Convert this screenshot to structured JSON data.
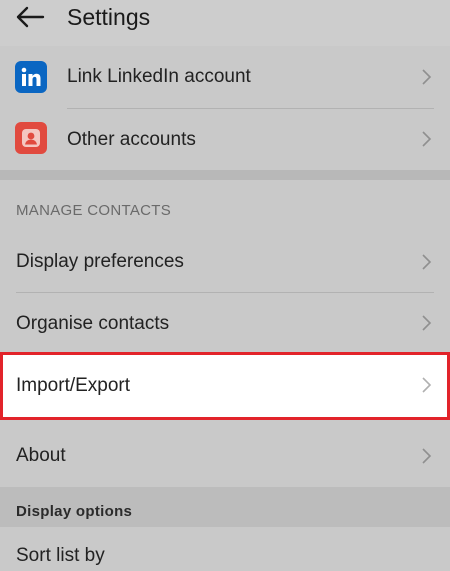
{
  "header": {
    "title": "Settings"
  },
  "accounts": [
    {
      "label": "Link LinkedIn account",
      "icon": "linkedin-icon",
      "color": "#0a66c2"
    },
    {
      "label": "Other accounts",
      "icon": "account-icon",
      "color": "#e14a3f"
    }
  ],
  "manage_contacts": {
    "section_title": "MANAGE CONTACTS",
    "items": [
      {
        "label": "Display preferences"
      },
      {
        "label": "Organise contacts"
      },
      {
        "label": "Import/Export",
        "highlighted": true
      },
      {
        "label": "About"
      }
    ]
  },
  "display_options": {
    "section_title": "Display options",
    "items": [
      {
        "label": "Sort list by"
      }
    ]
  },
  "colors": {
    "highlight_border": "#e2232a"
  }
}
